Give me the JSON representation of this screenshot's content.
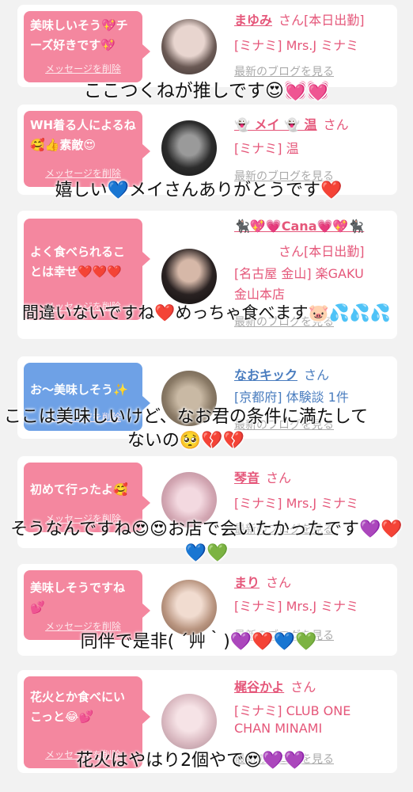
{
  "cards": [
    {
      "bubble_color": "pink",
      "bubble": "美味しいそう💖チーズ好きです💖",
      "delete_label": "メッセージを削除",
      "avatar_icon": "user-avatar-photo",
      "name": "まゆみ",
      "suffix": "さん[本日出勤]",
      "line2": "[ミナミ] Mrs.J ミナミ",
      "line3": "",
      "blog_label": "最新のブログを見る",
      "overlay": "ここつくねが推しです😍💓💓"
    },
    {
      "bubble_color": "pink",
      "bubble": "WH着る人によるね🥰👍素敵😍",
      "delete_label": "メッセージを削除",
      "avatar_icon": "user-avatar-photo",
      "name": "👻 メイ 👻 温",
      "suffix": "さん",
      "line2": "[ミナミ] 温",
      "line3": "",
      "blog_label": "最新のブログを見る",
      "overlay": "嬉しい💙メイさんありがとうです❤️"
    },
    {
      "bubble_color": "pink",
      "bubble": "よく食べられることは幸せ❤️❤️❤️",
      "delete_label": "メッセージを削除",
      "avatar_icon": "user-avatar-photo",
      "name": "🐈‍⬛💖💗Cana💗💖🐈‍⬛",
      "suffix": "さん[本日出勤]",
      "line2": "[名古屋 金山] 楽GAKU",
      "line3": "金山本店",
      "blog_label": "最新のブログを見る",
      "overlay": "間違いないですね❤️めっちゃ食べます🐷💦💦💦"
    },
    {
      "bubble_color": "blue",
      "bubble": "お〜美味しそう✨",
      "delete_label": "メッセージを削除",
      "avatar_icon": "user-avatar-photo",
      "name": "なおキック",
      "suffix": "さん",
      "line2": "[京都府] 体験談 1件",
      "line3": "",
      "blog_label": "最新のブログを見る",
      "overlay": "ここは美味しいけど、なお君の条件に満たしてないの🥺💔💔"
    },
    {
      "bubble_color": "pink",
      "bubble": "初めて行ったよ🥰",
      "delete_label": "メッセージを削除",
      "avatar_icon": "user-avatar-photo",
      "name": "琴音",
      "suffix": "さん",
      "line2": "[ミナミ] Mrs.J ミナミ",
      "line3": "",
      "blog_label": "最新のブログを見る",
      "overlay": "そうなんですね😍😍お店で会いたかったです💜❤️💙💚"
    },
    {
      "bubble_color": "pink",
      "bubble": "美味しそうですね💕",
      "delete_label": "メッセージを削除",
      "avatar_icon": "user-avatar-photo",
      "name": "まり",
      "suffix": "さん",
      "line2": "[ミナミ] Mrs.J ミナミ",
      "line3": "",
      "blog_label": "最新のブログを見る",
      "overlay": "同伴で是非( ´艸｀)💜❤️💙💚"
    },
    {
      "bubble_color": "pink",
      "bubble": "花火とか食べにいこっと😂💕",
      "delete_label": "メッセージを削除",
      "avatar_icon": "user-avatar-photo",
      "name": "梶谷かよ",
      "suffix": "さん",
      "line2": "[ミナミ] CLUB ONE",
      "line3": "CHAN MINAMI",
      "blog_label": "最新のブログを見る",
      "overlay": "花火はやはり2個やで😍💜💜"
    }
  ],
  "colors": {
    "accent_pink": "#f4879f",
    "accent_blue": "#6ea1e6",
    "name_pink": "#e5577a",
    "name_blue": "#4a7dbf"
  }
}
